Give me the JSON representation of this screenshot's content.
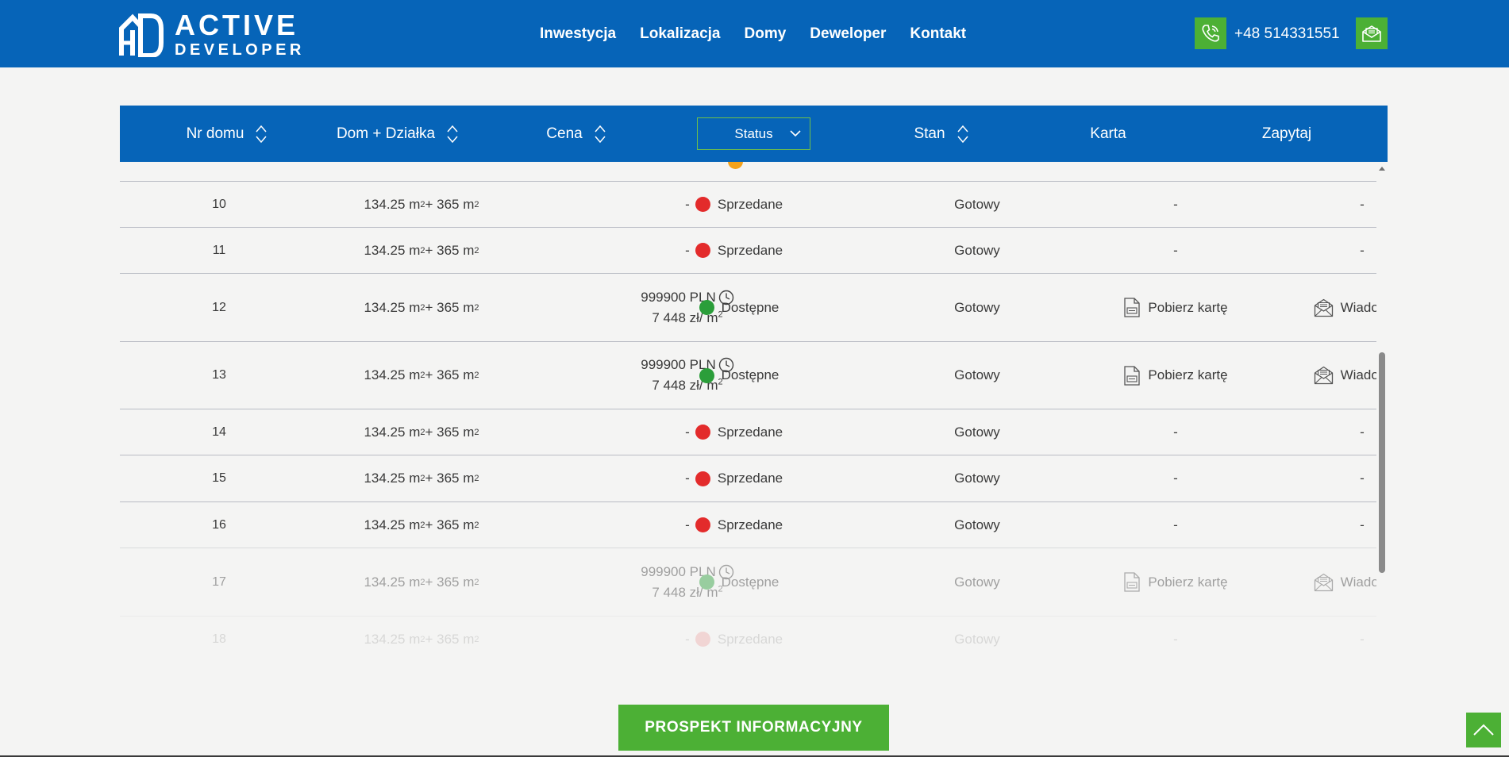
{
  "header": {
    "logo_line1": "ACTIVE",
    "logo_line2": "DEVELOPER",
    "nav": [
      "Inwestycja",
      "Lokalizacja",
      "Domy",
      "Deweloper",
      "Kontakt"
    ],
    "phone": "+48 514331551",
    "phone_icon": "phone-icon",
    "mail_icon": "mail-icon"
  },
  "colors": {
    "brand_blue": "#0664b8",
    "accent_green": "#4cb035",
    "status_sold": "#e32b2b",
    "status_available": "#2b9e3a",
    "status_reserved": "#f3a21b"
  },
  "table": {
    "columns": [
      "Nr domu",
      "Dom + Działka",
      "Cena",
      "Status",
      "Stan",
      "Karta",
      "Zapytaj"
    ],
    "area_house": "134.25 m",
    "area_plot": " + 365 m",
    "area_sup": "2",
    "rows": [
      {
        "nr": "10",
        "price": "-",
        "price_m2": "",
        "status": "Sprzedane",
        "state": "Gotowy",
        "card": "-",
        "ask": "-"
      },
      {
        "nr": "11",
        "price": "-",
        "price_m2": "",
        "status": "Sprzedane",
        "state": "Gotowy",
        "card": "-",
        "ask": "-"
      },
      {
        "nr": "12",
        "price": "999900 PLN",
        "price_m2": "7 448 zł/ m",
        "status": "Dostępne",
        "state": "Gotowy",
        "card": "Pobierz kartę",
        "ask": "Wiadomość"
      },
      {
        "nr": "13",
        "price": "999900 PLN",
        "price_m2": "7 448 zł/ m",
        "status": "Dostępne",
        "state": "Gotowy",
        "card": "Pobierz kartę",
        "ask": "Wiadomość"
      },
      {
        "nr": "14",
        "price": "-",
        "price_m2": "",
        "status": "Sprzedane",
        "state": "Gotowy",
        "card": "-",
        "ask": "-"
      },
      {
        "nr": "15",
        "price": "-",
        "price_m2": "",
        "status": "Sprzedane",
        "state": "Gotowy",
        "card": "-",
        "ask": "-"
      },
      {
        "nr": "16",
        "price": "-",
        "price_m2": "",
        "status": "Sprzedane",
        "state": "Gotowy",
        "card": "-",
        "ask": "-"
      },
      {
        "nr": "17",
        "price": "999900 PLN",
        "price_m2": "7 448 zł/ m",
        "status": "Dostępne",
        "state": "Gotowy",
        "card": "Pobierz kartę",
        "ask": "Wiadomość"
      },
      {
        "nr": "18",
        "price": "-",
        "price_m2": "",
        "status": "Sprzedane",
        "state": "Gotowy",
        "card": "-",
        "ask": "-"
      }
    ]
  },
  "prospekt_label": "PROSPEKT INFORMACYJNY",
  "scroll_top_icon": "chevron-up-icon"
}
